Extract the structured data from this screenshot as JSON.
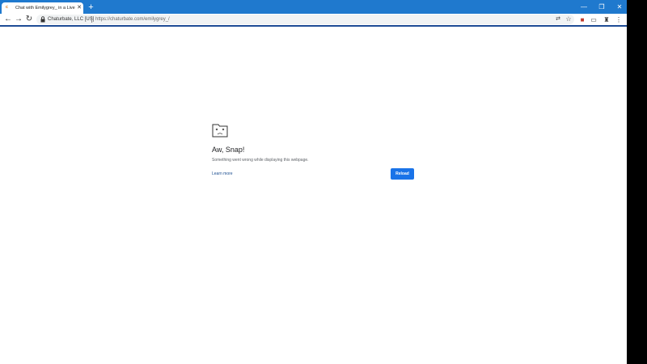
{
  "window": {
    "minimize_glyph": "—",
    "maximize_glyph": "❐",
    "close_glyph": "✕"
  },
  "tab": {
    "favicon_glyph": "ᶜ",
    "title": "Chat with Emilygrey_ in a Live Ad",
    "close_glyph": "✕"
  },
  "new_tab_glyph": "+",
  "toolbar": {
    "back_glyph": "←",
    "forward_glyph": "→",
    "reload_glyph": "↻",
    "site_identity": "Chaturbate, LLC [US]",
    "url": "https://chaturbate.com/emilygrey_/",
    "translate_glyph": "⇄",
    "star_glyph": "☆",
    "extension_glyphs": [
      "■",
      "▭",
      "♜"
    ],
    "menu_glyph": "⋮"
  },
  "error_page": {
    "title": "Aw, Snap!",
    "message": "Something went wrong while displaying this webpage.",
    "learn_more_label": "Learn more",
    "reload_label": "Reload"
  },
  "colors": {
    "tabstrip": "#1f79ce",
    "reload_button": "#1a73e8",
    "link": "#1a4d8f"
  },
  "icons": {
    "sad_tab": "sad-folder-icon"
  }
}
